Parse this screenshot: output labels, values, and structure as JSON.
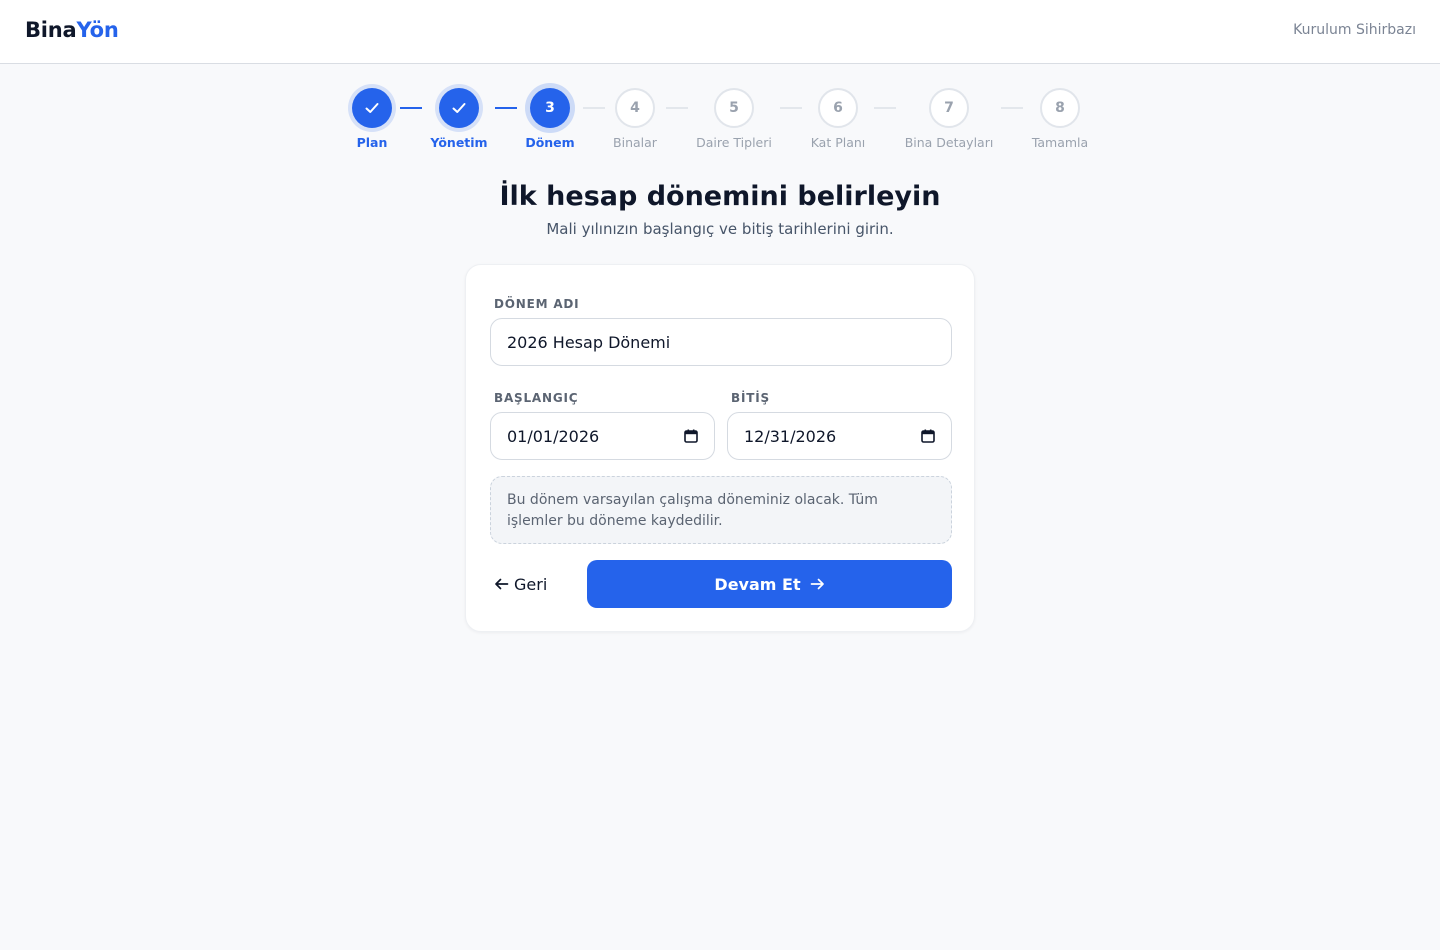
{
  "header": {
    "brand_primary": "Bina",
    "brand_accent": "Yön",
    "wizard_label": "Kurulum Sihirbazı"
  },
  "stepper": {
    "steps": [
      {
        "number": "1",
        "label": "Plan",
        "state": "done"
      },
      {
        "number": "2",
        "label": "Yönetim",
        "state": "done"
      },
      {
        "number": "3",
        "label": "Dönem",
        "state": "active"
      },
      {
        "number": "4",
        "label": "Binalar",
        "state": "todo"
      },
      {
        "number": "5",
        "label": "Daire Tipleri",
        "state": "todo"
      },
      {
        "number": "6",
        "label": "Kat Planı",
        "state": "todo"
      },
      {
        "number": "7",
        "label": "Bina Detayları",
        "state": "todo"
      },
      {
        "number": "8",
        "label": "Tamamla",
        "state": "todo"
      }
    ]
  },
  "page": {
    "title": "İlk hesap dönemini belirleyin",
    "subtitle": "Mali yılınızın başlangıç ve bitiş tarihlerini girin."
  },
  "form": {
    "period_name_label": "DÖNEM ADI",
    "period_name_value": "2026 Hesap Dönemi",
    "start_label": "BAŞLANGIÇ",
    "start_value": "01/01/2026",
    "end_label": "BİTİŞ",
    "end_value": "12/31/2026",
    "notice": "Bu dönem varsayılan çalışma döneminiz olacak. Tüm işlemler bu döneme kaydedilir.",
    "back_label": "Geri",
    "continue_label": "Devam Et"
  },
  "colors": {
    "accent": "#2563eb",
    "background": "#f8f9fb",
    "text": "#0f172a",
    "muted": "#9aa2ae"
  }
}
